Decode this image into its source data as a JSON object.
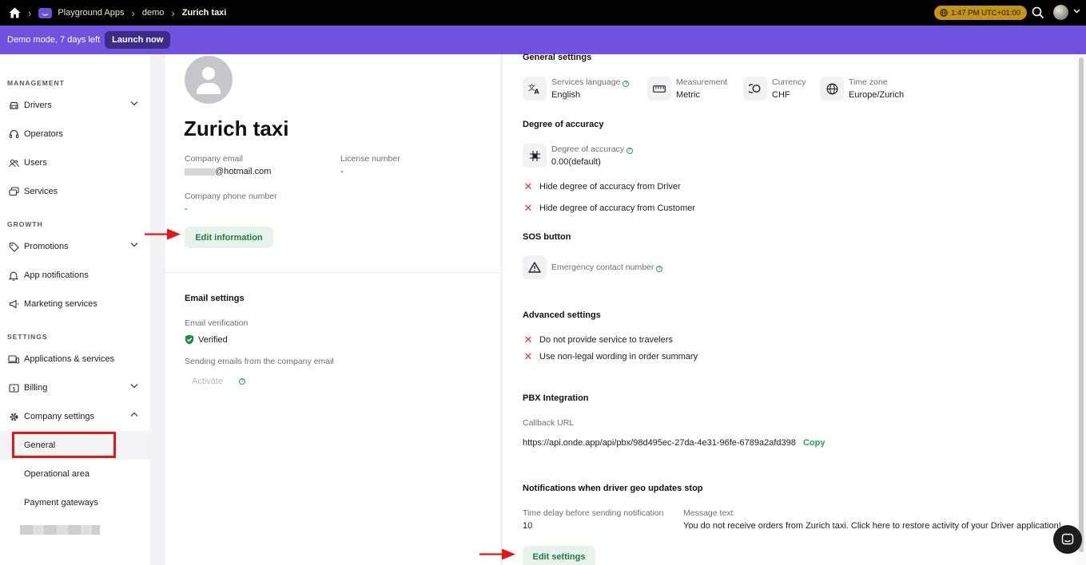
{
  "topbar": {
    "breadcrumb": [
      "Playground Apps",
      "demo",
      "Zurich taxi"
    ],
    "time": "1:47 PM UTC+01:00"
  },
  "demo": {
    "text": "Demo mode, 7 days left",
    "launch_label": "Launch now"
  },
  "sidebar": {
    "sections": {
      "management": "MANAGEMENT",
      "growth": "GROWTH",
      "settings": "SETTINGS"
    },
    "items": {
      "drivers": "Drivers",
      "operators": "Operators",
      "users": "Users",
      "services": "Services",
      "promotions": "Promotions",
      "app_notifications": "App notifications",
      "marketing": "Marketing services",
      "applications": "Applications & services",
      "billing": "Billing",
      "company_settings": "Company settings",
      "general": "General",
      "operational_area": "Operational area",
      "payment_gateways": "Payment gateways"
    }
  },
  "company": {
    "name": "Zurich taxi",
    "email_label": "Company email",
    "email_value": "@hotmail.com",
    "license_label": "License number",
    "license_value": "-",
    "phone_label": "Company phone number",
    "phone_value": "-",
    "edit_label": "Edit information"
  },
  "email_settings": {
    "title": "Email settings",
    "verification_label": "Email verification",
    "verified": "Verified",
    "sending_label": "Sending emails from the company email",
    "activate": "Activate"
  },
  "general_settings": {
    "title": "General settings",
    "language_label": "Services language",
    "language_value": "English",
    "measurement_label": "Measurement",
    "measurement_value": "Metric",
    "currency_label": "Currency",
    "currency_value": "CHF",
    "timezone_label": "Time zone",
    "timezone_value": "Europe/Zurich"
  },
  "accuracy": {
    "title": "Degree of accuracy",
    "label": "Degree of accuracy",
    "value": "0.00(default)",
    "hide_driver": "Hide degree of accuracy from Driver",
    "hide_customer": "Hide degree of accuracy from Customer"
  },
  "sos": {
    "title": "SOS button",
    "label": "Emergency contact number"
  },
  "advanced": {
    "title": "Advanced settings",
    "no_travelers": "Do not provide service to travelers",
    "non_legal": "Use non-legal wording in order summary"
  },
  "pbx": {
    "title": "PBX Integration",
    "callback_label": "Callback URL",
    "callback_url": "https://api.onde.app/api/pbx/98d495ec-27da-4e31-96fe-6789a2afd398",
    "copy_label": "Copy"
  },
  "geo": {
    "title": "Notifications when driver geo updates stop",
    "delay_label": "Time delay before sending notification",
    "delay_value": "10",
    "message_label": "Message text",
    "message_value": "You do not receive orders from Zurich taxi. Click here to restore activity of your Driver application!"
  },
  "edit_settings_label": "Edit settings",
  "colors": {
    "accent_purple": "#7052e1",
    "green": "#2e9c5a",
    "red": "#e01818"
  }
}
